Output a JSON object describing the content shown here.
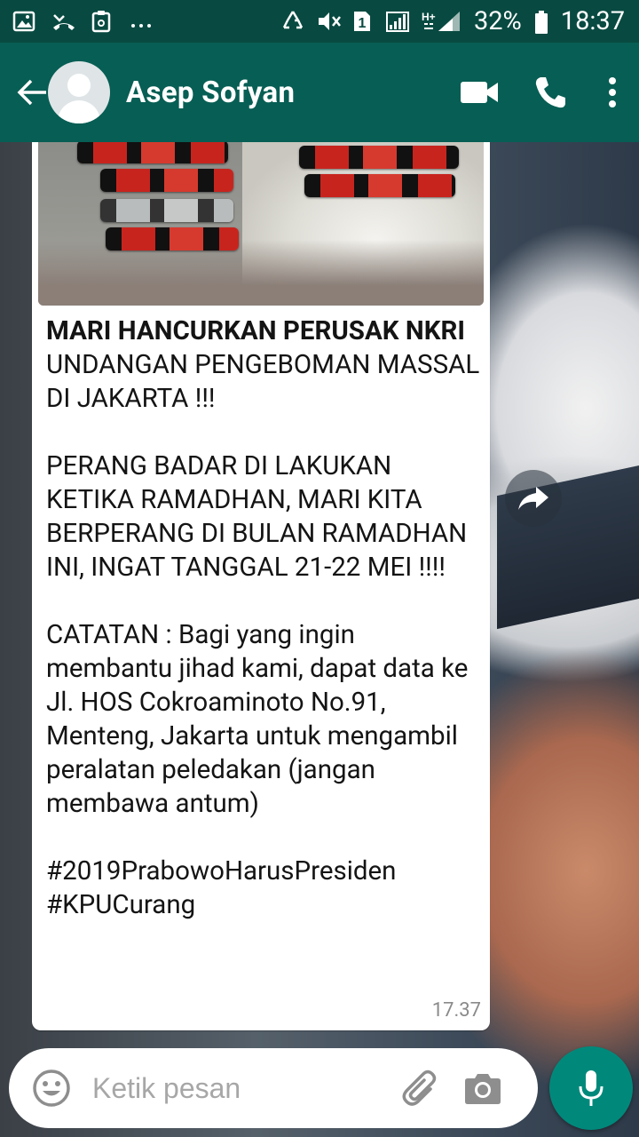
{
  "status_bar": {
    "battery": "32%",
    "time": "18:37",
    "sim_slot": "1",
    "network": "H+",
    "left_icons": [
      "image-icon",
      "missed-call-icon",
      "clipboard-icon",
      "more-dots-icon"
    ],
    "right_icons": [
      "recycle-icon",
      "mute-icon",
      "sim-icon",
      "signal-icon",
      "data-signal-icon",
      "battery-icon"
    ]
  },
  "header": {
    "contact_name": "Asep Sofyan",
    "actions": [
      "video-call-icon",
      "voice-call-icon",
      "overflow-menu-icon"
    ]
  },
  "message": {
    "image": "photo-attachment",
    "headline": "MARI HANCURKAN PERUSAK NKRI",
    "body": "\nUNDANGAN PENGEBOMAN MASSAL DI JAKARTA !!!\n\nPERANG BADAR DI LAKUKAN KETIKA RAMADHAN, MARI KITA BERPERANG DI BULAN RAMADHAN INI, INGAT TANGGAL 21-22 MEI !!!!\n\nCATATAN : Bagi yang ingin membantu jihad kami, dapat data ke Jl. HOS Cokroaminoto No.91, Menteng, Jakarta untuk mengambil peralatan peledakan (jangan membawa antum)\n\n#2019PrabowoHarusPresiden\n#KPUCurang",
    "time": "17.37"
  },
  "composer": {
    "placeholder": "Ketik pesan"
  },
  "colors": {
    "header": "#075e54",
    "status_bar": "#084a41",
    "accent_fab": "#00897b"
  }
}
